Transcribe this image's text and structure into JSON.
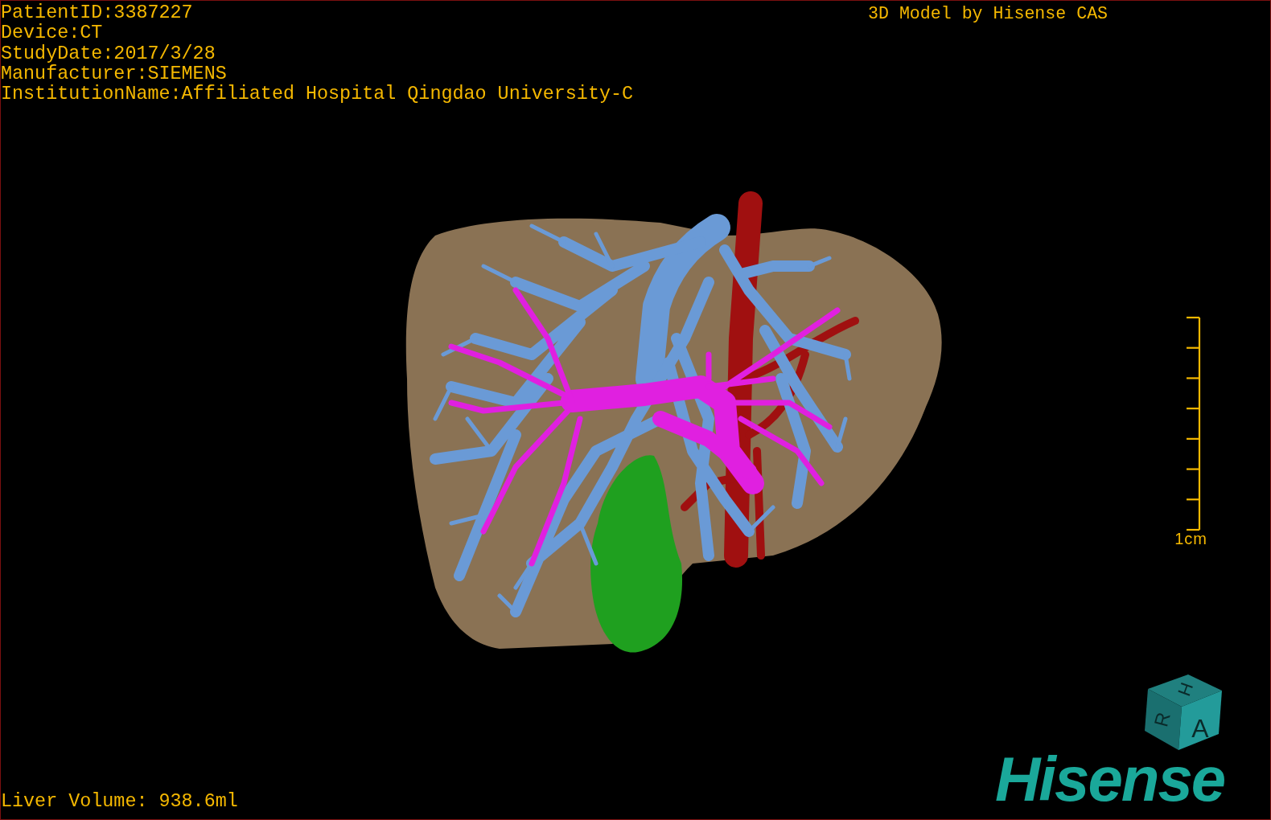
{
  "info_lines": [
    "PatientID:3387227",
    "Device:CT",
    "StudyDate:2017/3/28",
    "Manufacturer:SIEMENS",
    "InstitutionName:Affiliated Hospital Qingdao University-C"
  ],
  "title": "3D Model by Hisense CAS",
  "scale_bar": {
    "label": "1cm"
  },
  "orientation_cube": {
    "faces": [
      "H",
      "R",
      "A"
    ]
  },
  "logo": "Hisense",
  "liver_volume": "Liver Volume: 938.6ml"
}
